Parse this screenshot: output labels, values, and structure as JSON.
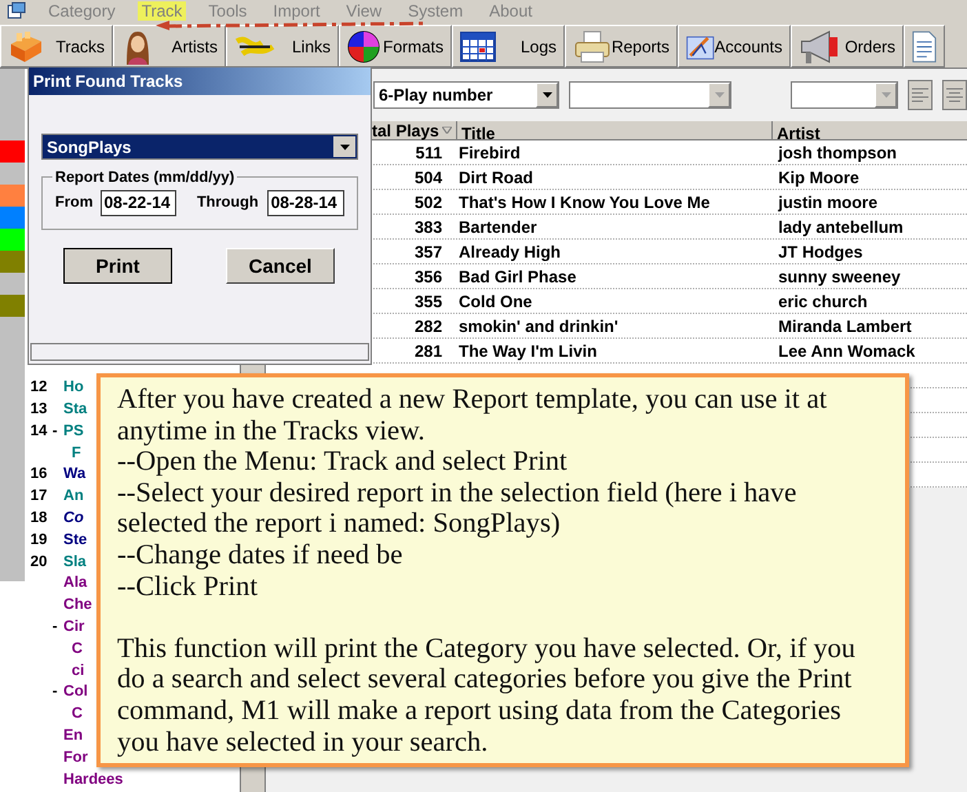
{
  "menu": [
    {
      "label": "Category",
      "selected": false
    },
    {
      "label": "Track",
      "selected": true
    },
    {
      "label": "Tools",
      "selected": false
    },
    {
      "label": "Import",
      "selected": false
    },
    {
      "label": "View",
      "selected": false
    },
    {
      "label": "System",
      "selected": false
    },
    {
      "label": "About",
      "selected": false
    }
  ],
  "toolbar": [
    {
      "kind": "tracks",
      "label": "Tracks"
    },
    {
      "kind": "artists",
      "label": "Artists"
    },
    {
      "kind": "links",
      "label": "Links"
    },
    {
      "kind": "formats",
      "label": "Formats"
    },
    {
      "kind": "logs",
      "label": "Logs"
    },
    {
      "kind": "reports",
      "label": "Reports"
    },
    {
      "kind": "accounts",
      "label": "Accounts"
    },
    {
      "kind": "orders",
      "label": "Orders"
    },
    {
      "kind": "document"
    }
  ],
  "color_markers": [
    {
      "kind": "marker",
      "color": "#ff0000"
    },
    {
      "kind": "gap"
    },
    {
      "kind": "marker",
      "color": "#ff8040"
    },
    {
      "kind": "marker",
      "color": "#0080ff"
    },
    {
      "kind": "marker",
      "color": "#00ff00"
    },
    {
      "kind": "marker",
      "color": "#808000"
    },
    {
      "kind": "gap"
    },
    {
      "kind": "marker",
      "color": "#808000"
    }
  ],
  "categories": [
    {
      "number": "12",
      "name": "Ho",
      "color": "#008080",
      "italic": false
    },
    {
      "number": "13",
      "name": "Sta",
      "color": "#008080",
      "italic": false
    },
    {
      "number": "14",
      "name": "PS",
      "color": "#008080",
      "italic": false,
      "expander": "-",
      "children": [
        {
          "name": "F",
          "color": "#008080"
        }
      ]
    },
    {
      "number": "16",
      "name": "Wa",
      "color": "#000080",
      "italic": false
    },
    {
      "number": "17",
      "name": "An",
      "color": "#008080",
      "italic": false
    },
    {
      "number": "18",
      "name": "Co",
      "color": "#000080",
      "italic": true
    },
    {
      "number": "19",
      "name": "Ste",
      "color": "#000080",
      "italic": false
    },
    {
      "number": "20",
      "name": "Sla",
      "color": "#008080",
      "italic": false
    },
    {
      "name": "Ala",
      "color": "#800080",
      "italic": false
    },
    {
      "name": "Che",
      "color": "#800080",
      "italic": false
    },
    {
      "name": "Cir",
      "color": "#800080",
      "italic": false,
      "expander": "-",
      "children": [
        {
          "name": "C",
          "color": "#800080"
        },
        {
          "name": "ci",
          "color": "#800080"
        }
      ]
    },
    {
      "name": "Col",
      "color": "#800080",
      "italic": false,
      "expander": "-",
      "children": [
        {
          "name": "C",
          "color": "#800080"
        }
      ]
    },
    {
      "name": "En",
      "color": "#800080",
      "italic": false
    },
    {
      "name": "For",
      "color": "#800080",
      "italic": false
    },
    {
      "name": "Hardees",
      "color": "#800080",
      "italic": false
    }
  ],
  "filters": [
    {
      "value": "6-Play number",
      "disabled": false
    },
    {
      "disabled": true
    },
    {
      "disabled": true
    }
  ],
  "table": {
    "columns": [
      "tal Plays",
      "Title",
      "Artist"
    ],
    "rows": [
      [
        "511",
        "Firebird",
        "josh thompson"
      ],
      [
        "504",
        "Dirt Road",
        "Kip Moore"
      ],
      [
        "502",
        "That's How I Know You Love Me",
        "justin moore"
      ],
      [
        "383",
        "Bartender",
        "lady antebellum"
      ],
      [
        "357",
        "Already High",
        "JT Hodges"
      ],
      [
        "356",
        "Bad Girl Phase",
        "sunny sweeney"
      ],
      [
        "355",
        "Cold One",
        "eric church"
      ],
      [
        "282",
        "smokin' and drinkin'",
        "Miranda Lambert"
      ],
      [
        "281",
        "The Way I'm Livin",
        "Lee Ann Womack"
      ]
    ]
  },
  "dialog": {
    "title": "Print Found Tracks",
    "report": "SongPlays",
    "group_label": "Report Dates (mm/dd/yy)",
    "from_label": "From",
    "from": "08-22-14",
    "through_label": "Through",
    "through": "08-28-14",
    "buttons": [
      "Print",
      "Cancel"
    ]
  },
  "callout": {
    "paragraphs": [
      [
        "After you have created a new Report template, you can use it at anytime in the Tracks view.",
        "--Open the Menu: Track and select Print",
        "--Select your desired report in the selection field (here i have selected the report i named: SongPlays)",
        "--Change dates if need be",
        "--Click Print"
      ],
      [
        "This function will print the Category you have selected.  Or, if you do a search and select several categories before you give the Print command, M1 will make a report using data from the Categories you have selected in your search."
      ]
    ]
  }
}
